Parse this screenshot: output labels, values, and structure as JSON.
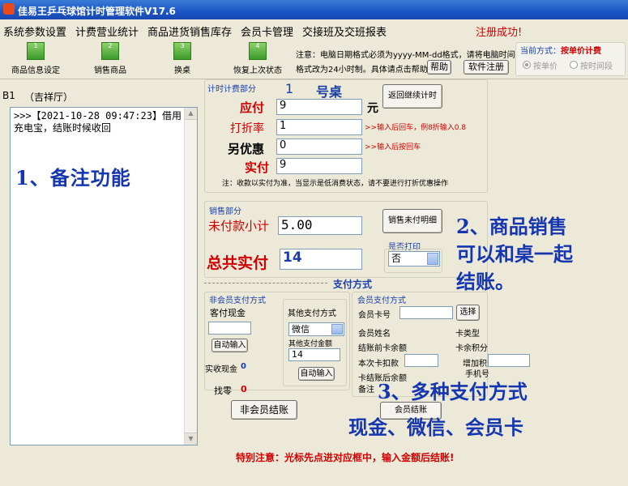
{
  "window": {
    "title": "佳易王乒乓球馆计时管理软件V17.6"
  },
  "menu": [
    "系统参数设置",
    "计费营业统计",
    "商品进货销售库存",
    "会员卡管理",
    "交接班及交班报表"
  ],
  "status_msg": "注册成功!",
  "toolbar": [
    {
      "label": "商品信息设定",
      "num": "1"
    },
    {
      "label": "销售商品",
      "num": "2"
    },
    {
      "label": "换桌",
      "num": "3"
    },
    {
      "label": "恢复上次状态",
      "num": "4"
    }
  ],
  "notice": {
    "line1": "注意：电脑日期格式必须为yyyy-MM-dd格式，请将电脑时间",
    "line2": "格式改为24小时制。具体请点击帮助"
  },
  "help_btn": "帮助",
  "register_btn": "软件注册",
  "billing_mode": {
    "title": "当前方式：",
    "value": "按单价计费",
    "opt1": "按单价",
    "opt2": "按时间段"
  },
  "table": {
    "code": "B1",
    "name": "（吉祥厅）",
    "remark": ">>>【2021-10-28 09:47:23】借用充电宝，结账时候收回"
  },
  "timing": {
    "section": "计时计费部分",
    "table_no": "1",
    "table_suffix": "号桌",
    "payable_label": "应付",
    "payable": "9",
    "yuan": "元",
    "return_btn": "返回继续计时",
    "discount_label": "打折率",
    "discount": "1",
    "discount_hint": ">>输入后回车，例8折输入0.8",
    "extra_label": "另优惠",
    "extra": "0",
    "extra_hint": ">>输入后按回车",
    "actual_label": "实付",
    "actual": "9",
    "note": "注：收款以实付为准，当显示是低消费状态，请不要进行打折优惠操作"
  },
  "sales": {
    "section": "销售部分",
    "unpaid_label": "未付款小计",
    "unpaid": "5.00",
    "detail_btn": "销售未付明细",
    "total_label": "总共实付",
    "total": "14",
    "print_label": "是否打印",
    "print_value": "否"
  },
  "payment": {
    "title": "支付方式",
    "non_member_title": "非会员支付方式",
    "cash_label": "客付现金",
    "auto_btn": "自动输入",
    "other_label": "其他支付方式",
    "other_value": "微信",
    "other_amount_label": "其他支付金额",
    "other_amount": "14",
    "auto_btn2": "自动输入",
    "received_label": "实收现金",
    "received": "0",
    "change_label": "找零",
    "change": "0",
    "checkout_btn": "非会员结账",
    "member_title": "会员支付方式",
    "card_no_label": "会员卡号",
    "select_btn": "选择",
    "card_type_label": "卡类型",
    "name_label": "会员姓名",
    "balance_before_label": "结账前卡余额",
    "points_label": "卡余积分",
    "deduct_label": "本次卡扣款",
    "add_points_label": "增加积分",
    "phone_label": "手机号",
    "balance_after_label": "卡结账后余额",
    "remark_label": "备注",
    "member_btn": "会员结账"
  },
  "footer": "特别注意：光标先点进对应框中，输入金额后结账!",
  "annotations": {
    "a1": "1、备注功能",
    "a2": [
      "2、商品销售",
      "可以和桌一起",
      "结账。"
    ],
    "a3": [
      "3、多种支付方式",
      "现金、微信、会员卡"
    ]
  }
}
